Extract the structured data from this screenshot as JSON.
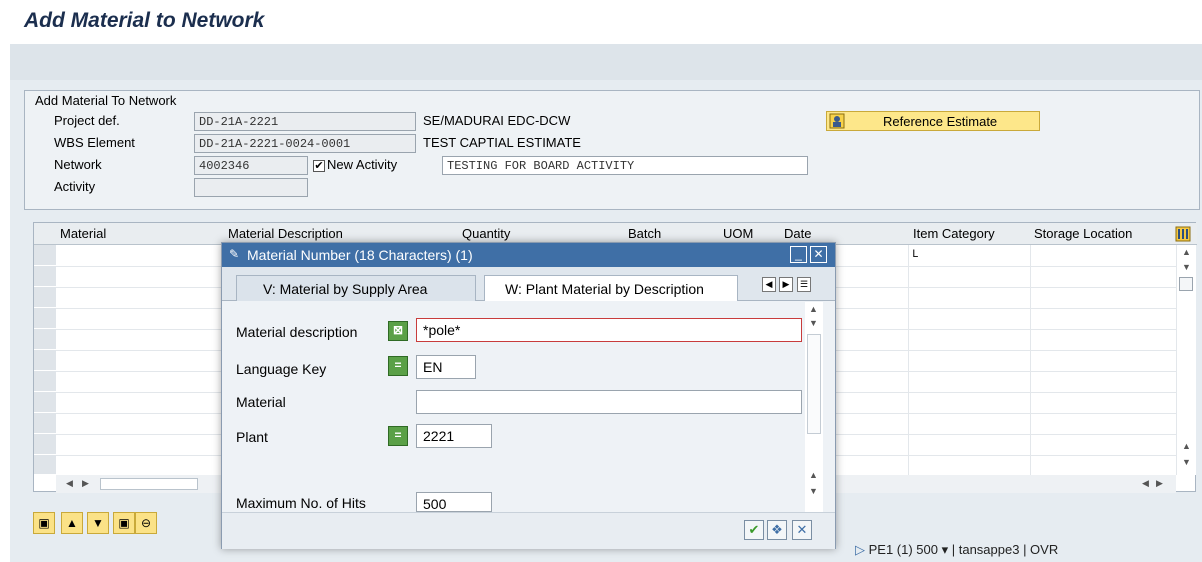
{
  "page": {
    "title": "Add Material to Network"
  },
  "group": {
    "title": "Add Material To Network",
    "project_label": "Project def.",
    "project_value": "DD-21A-2221",
    "project_desc": "SE/MADURAI EDC-DCW",
    "wbs_label": "WBS Element",
    "wbs_value": "DD-21A-2221-0024-0001",
    "wbs_desc": "TEST CAPTIAL ESTIMATE",
    "network_label": "Network",
    "network_value": "4002346",
    "new_activity_label": "New Activity",
    "new_activity_checked": "✔",
    "activity_desc_value": "TESTING FOR BOARD ACTIVITY",
    "activity_label": "Activity",
    "activity_value": "",
    "reference_button": "Reference Estimate"
  },
  "table": {
    "columns": [
      "Material",
      "Material Description",
      "Quantity",
      "Batch",
      "UOM",
      "Date",
      "Item Category",
      "Storage Location"
    ],
    "first_row_item_category": "L"
  },
  "dialog": {
    "title": "Material Number (18 Characters) (1)",
    "tab_v": "V: Material by Supply Area",
    "tab_w": "W: Plant Material by Description",
    "fields": {
      "material_description_label": "Material description",
      "material_description_value": "*pole*",
      "language_key_label": "Language Key",
      "language_key_value": "EN",
      "material_label": "Material",
      "material_value": "",
      "plant_label": "Plant",
      "plant_value": "2221",
      "max_hits_label": "Maximum No. of Hits",
      "max_hits_value": "500"
    }
  },
  "status": {
    "text": "PE1 (1) 500 ▾ | tansappe3 | OVR"
  },
  "colors": {
    "title": "#1b2e4e",
    "dialog_header": "#3f6fa6",
    "button_yellow": "#fde78a",
    "select_green": "#5aa047"
  }
}
